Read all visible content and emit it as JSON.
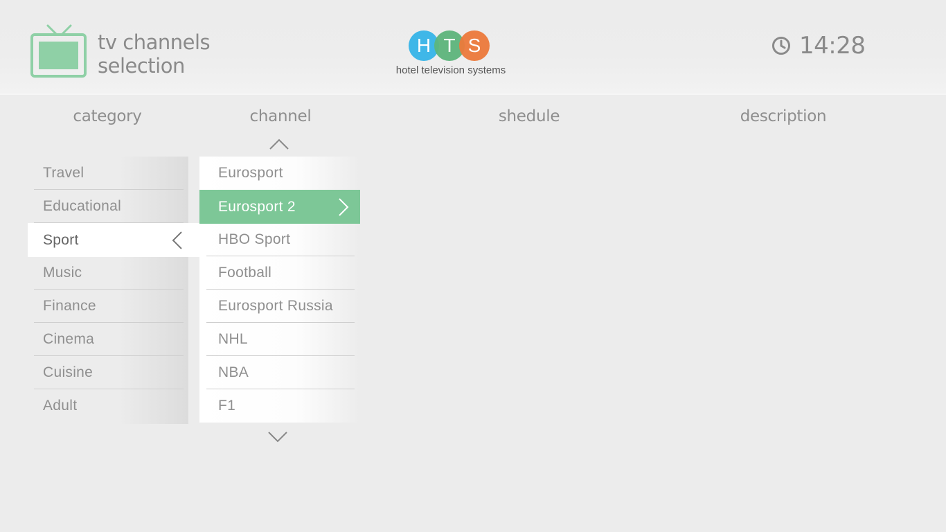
{
  "header": {
    "title_line1": "tv channels",
    "title_line2": "selection",
    "logo": {
      "letters": [
        "H",
        "T",
        "S"
      ],
      "tagline": "hotel television systems",
      "colors": [
        "#3fb7e8",
        "#5db57c",
        "#ec7a3b"
      ]
    },
    "clock": {
      "time": "14:28"
    }
  },
  "columns": {
    "category": "category",
    "channel": "channel",
    "schedule": "shedule",
    "description": "description"
  },
  "categories": {
    "items": [
      "Travel",
      "Educational",
      "Sport",
      "Music",
      "Finance",
      "Cinema",
      "Cuisine",
      "Adult"
    ],
    "selected": "Sport"
  },
  "channels": {
    "items": [
      "Eurosport",
      "Eurosport 2",
      "HBO Sport",
      "Football",
      "Eurosport Russia",
      "NHL",
      "NBA",
      "F1"
    ],
    "selected": "Eurosport 2"
  },
  "colors": {
    "accent": "#7dc797",
    "background": "#ececec",
    "text": "#8f8f8f"
  }
}
